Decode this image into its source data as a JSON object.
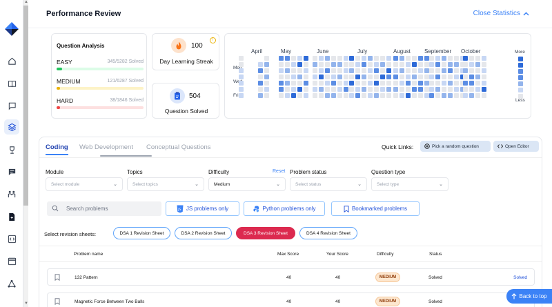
{
  "header": {
    "title": "Performance Review",
    "close_label": "Close Statistics"
  },
  "question_analysis": {
    "title": "Question Analysis",
    "rows": [
      {
        "label": "EASY",
        "count": "345/5282 Solved",
        "percent": 6.5,
        "color": "#22c55e",
        "track": "#dcfce7"
      },
      {
        "label": "MEDIUM",
        "count": "121/6287 Solved",
        "percent": 1.9,
        "color": "#eab308",
        "track": "#fdf3c7"
      },
      {
        "label": "HARD",
        "count": "38/1846 Solved",
        "percent": 2.1,
        "color": "#ef4444",
        "track": "#fde0e0"
      }
    ]
  },
  "streak": {
    "value": "100",
    "label": "Day Learning Streak"
  },
  "solved": {
    "value": "504",
    "label": "Question Solved"
  },
  "heatmap": {
    "months": [
      "April",
      "May",
      "June",
      "July",
      "August",
      "September",
      "October"
    ],
    "days": [
      "Mon",
      "Wed",
      "Fri"
    ],
    "legend_more": "More",
    "legend_less": "Less",
    "colors": [
      "#e5e7eb",
      "#c7d7f4",
      "#93b4ec",
      "#5b8de4",
      "#2d6ad8"
    ]
  },
  "tabs": [
    "Coding",
    "Web Development",
    "Conceptual Questions"
  ],
  "quick_links": {
    "label": "Quick Links:",
    "random": "Pick a random question",
    "editor": "Open Editor"
  },
  "filters": {
    "module": {
      "label": "Module",
      "placeholder": "Select module"
    },
    "topics": {
      "label": "Topics",
      "placeholder": "Select topics"
    },
    "difficulty": {
      "label": "Difficulty",
      "value": "Medium",
      "reset": "Reset"
    },
    "status": {
      "label": "Problem status",
      "placeholder": "Select status"
    },
    "type": {
      "label": "Question type",
      "placeholder": "Select type"
    }
  },
  "search": {
    "placeholder": "Search problems"
  },
  "toggles": {
    "js": "JS problems only",
    "python": "Python problems only",
    "bookmarked": "Bookmarked problems"
  },
  "revision": {
    "label": "Select revision sheets:",
    "sheets": [
      "DSA 1 Revision Sheet",
      "DSA 2 Revision Sheet",
      "DSA 3 Revision Sheet",
      "DSA 4 Revision Sheet"
    ]
  },
  "table": {
    "headers": [
      "Problem name",
      "Max Score",
      "Your Score",
      "Difficulty",
      "Status"
    ],
    "rows": [
      {
        "name": "132 Pattern",
        "max": "40",
        "score": "40",
        "difficulty": "MEDIUM",
        "status": "Solved",
        "action": "Solved"
      },
      {
        "name": "Magnetic Force Between Two Balls",
        "max": "40",
        "score": "40",
        "difficulty": "MEDIUM",
        "status": "Solved",
        "action": ""
      }
    ]
  },
  "back_to_top": "Back to top"
}
